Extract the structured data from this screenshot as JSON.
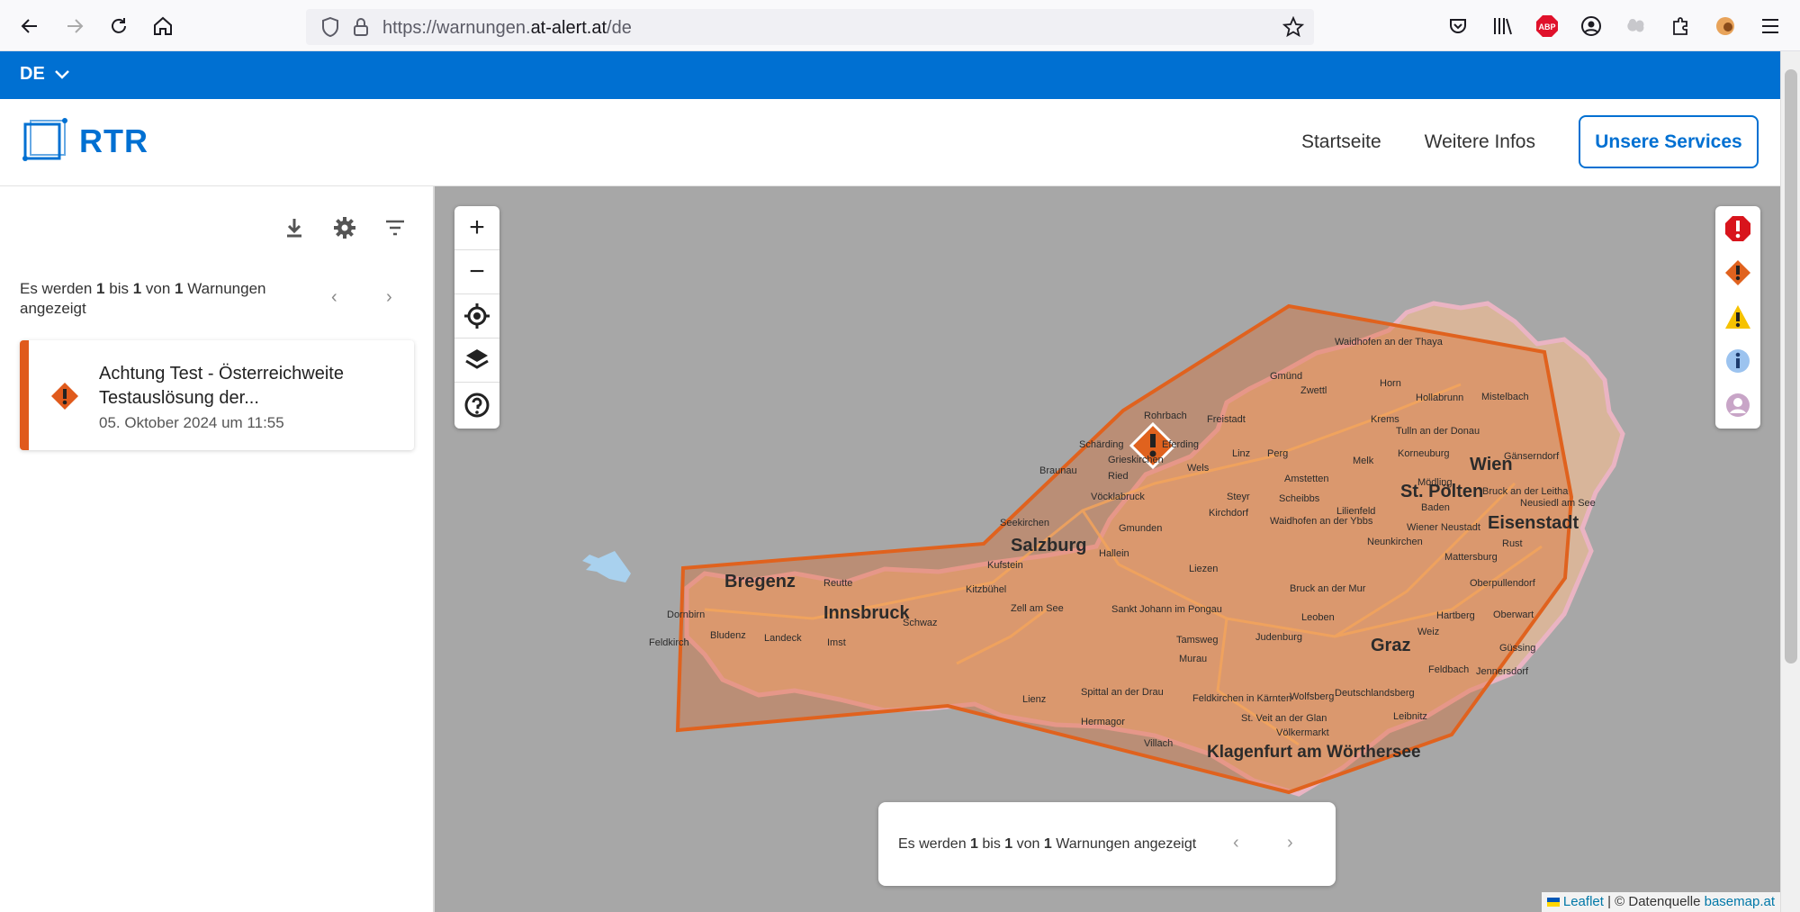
{
  "browser": {
    "url_prefix": "https://warnungen.",
    "url_domain": "at-alert.at",
    "url_path": "/de",
    "icons": [
      "back-icon",
      "forward-icon",
      "reload-icon",
      "home-icon",
      "shield-icon",
      "lock-icon",
      "star-icon",
      "pocket-icon",
      "library-icon",
      "adblock-icon",
      "account-icon",
      "extension-icon",
      "puzzle-icon",
      "profile-icon",
      "menu-icon"
    ],
    "adblock_label": "ABP"
  },
  "lang_bar": {
    "language": "DE"
  },
  "header": {
    "logo_text": "RTR",
    "nav": [
      "Startseite",
      "Weitere Infos"
    ],
    "services_label": "Unsere Services"
  },
  "sidebar": {
    "count_prefix": "Es werden ",
    "count_from": "1",
    "count_mid1": " bis ",
    "count_to": "1",
    "count_mid2": " von ",
    "count_total": "1",
    "count_suffix": " Warnungen angezeigt",
    "warnings": [
      {
        "title": "Achtung Test - Österreichweite Testauslösung der...",
        "date": "05. Oktober 2024 um 11:55",
        "severity_color": "#e05a1c"
      }
    ]
  },
  "map": {
    "labels": [
      "Bregenz",
      "Innsbruck",
      "Salzburg",
      "Wien",
      "St. Pölten",
      "Eisenstadt",
      "Graz",
      "Klagenfurt am Wörthersee",
      "Dornbirn",
      "Feldkirch",
      "Bludenz",
      "Landeck",
      "Imst",
      "Reutte",
      "Kufstein",
      "Kitzbühel",
      "Schwaz",
      "Zell am See",
      "Lienz",
      "Spittal an der Drau",
      "Hermagor",
      "Villach",
      "Feldkirchen in Kärnten",
      "Wolfsberg",
      "St. Veit an der Glan",
      "Völkermarkt",
      "Deutschlandsberg",
      "Leibnitz",
      "Feldbach",
      "Weiz",
      "Hartberg",
      "Oberwart",
      "Güssing",
      "Jennersdorf",
      "Leoben",
      "Bruck an der Mur",
      "Judenburg",
      "Murau",
      "Tamsweg",
      "Liezen",
      "Sankt Johann im Pongau",
      "Hallein",
      "Gmunden",
      "Vöcklabruck",
      "Braunau",
      "Ried",
      "Schärding",
      "Grieskirchen",
      "Eferding",
      "Wels",
      "Linz",
      "Steyr",
      "Kirchdorf",
      "Rohrbach",
      "Freistadt",
      "Perg",
      "Amstetten",
      "Melk",
      "Scheibbs",
      "Waidhofen an der Ybbs",
      "Lilienfeld",
      "Baden",
      "Mödling",
      "Wiener Neustadt",
      "Neunkirchen",
      "Mattersburg",
      "Oberpullendorf",
      "Rust",
      "Neusiedl am See",
      "Bruck an der Leitha",
      "Gänserndorf",
      "Mistelbach",
      "Korneuburg",
      "Tulln an der Donau",
      "Hollabrunn",
      "Horn",
      "Gmünd",
      "Zwettl",
      "Waidhofen an der Thaya",
      "Krems",
      "Seekirchen"
    ],
    "bottom_prefix": "Es werden ",
    "bottom_from": "1",
    "bottom_mid1": " bis ",
    "bottom_to": "1",
    "bottom_mid2": " von ",
    "bottom_total": "1",
    "bottom_suffix": " Warnungen angezeigt",
    "attribution_leaflet": "Leaflet",
    "attribution_sep": " | © Datenquelle ",
    "attribution_source": "basemap.at",
    "severity_icons": [
      "extreme-icon",
      "severe-icon",
      "moderate-icon",
      "info-icon",
      "user-icon"
    ],
    "colors": {
      "area_fill": "#d9825a",
      "area_stroke": "#e0621e",
      "map_bg": "#a7a7a7"
    }
  }
}
